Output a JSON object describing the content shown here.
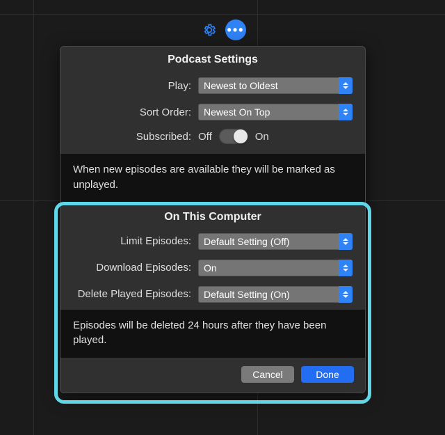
{
  "icons": {
    "gear": "gear-icon",
    "more": "more-icon"
  },
  "panel": {
    "title": "Podcast Settings",
    "play": {
      "label": "Play:",
      "value": "Newest to Oldest"
    },
    "sort": {
      "label": "Sort Order:",
      "value": "Newest On Top"
    },
    "subscribed": {
      "label": "Subscribed:",
      "off": "Off",
      "on": "On"
    },
    "note1": "When new episodes are available they will be marked as unplayed.",
    "section2_title": "On This Computer",
    "limit": {
      "label": "Limit Episodes:",
      "value": "Default Setting (Off)"
    },
    "download": {
      "label": "Download Episodes:",
      "value": "On"
    },
    "delete": {
      "label": "Delete Played Episodes:",
      "value": "Default Setting (On)"
    },
    "note2": "Episodes will be deleted 24 hours after they have been played.",
    "buttons": {
      "cancel": "Cancel",
      "done": "Done"
    }
  },
  "colors": {
    "accent": "#2f83f6",
    "highlight": "#5fd7e8"
  }
}
